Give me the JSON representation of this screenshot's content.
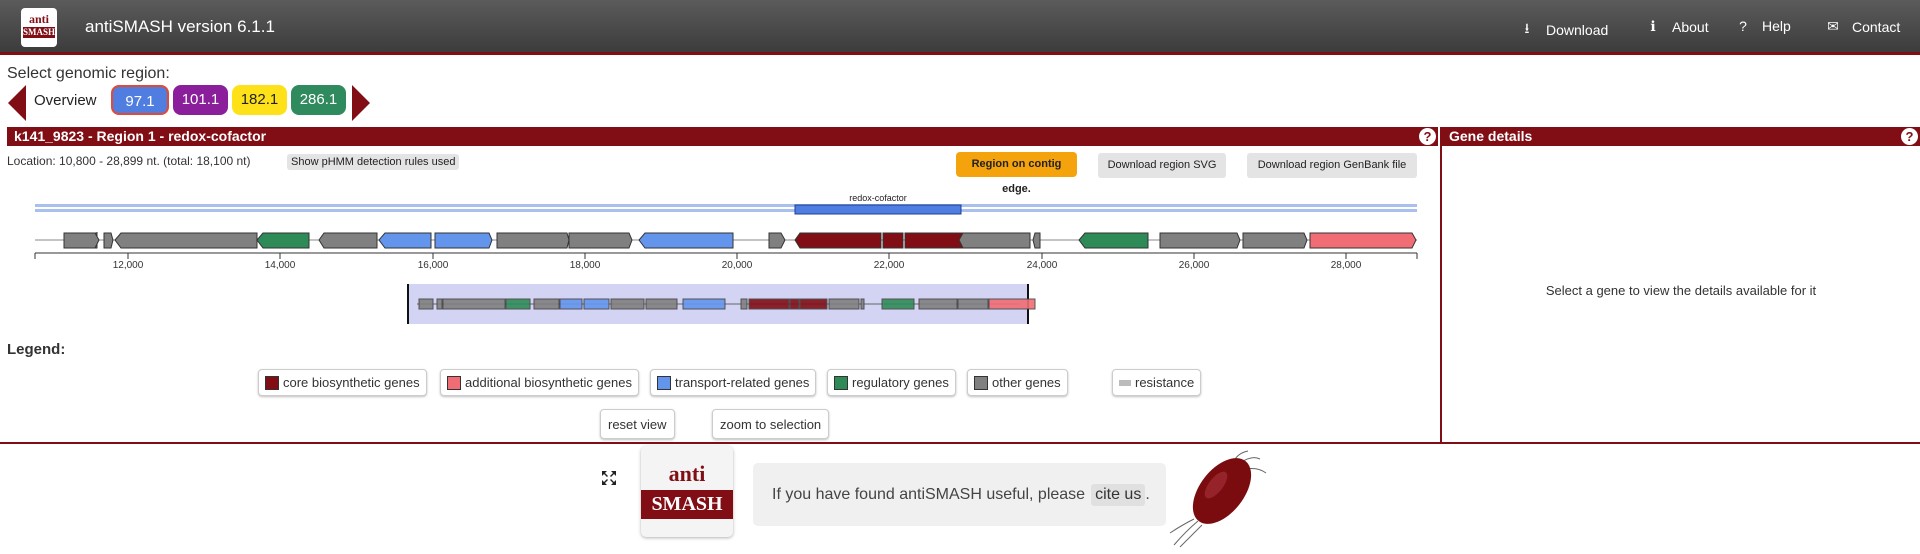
{
  "header": {
    "logo_top": "anti",
    "logo_bottom": "SMASH",
    "title": "antiSMASH version 6.1.1",
    "nav": [
      {
        "label": "Download",
        "icon": "download-icon",
        "glyph": "⭳"
      },
      {
        "label": "About",
        "icon": "info-icon",
        "glyph": "ℹ"
      },
      {
        "label": "Help",
        "icon": "question-icon",
        "glyph": "?"
      },
      {
        "label": "Contact",
        "icon": "envelope-icon",
        "glyph": "✉"
      }
    ]
  },
  "region_select": {
    "label": "Select genomic region:",
    "overview_label": "Overview",
    "regions": [
      {
        "label": "97.1",
        "color": "#4f7de0",
        "selected": true
      },
      {
        "label": "101.1",
        "color": "#8a1e9b"
      },
      {
        "label": "182.1",
        "color": "#ffe11a"
      },
      {
        "label": "286.1",
        "color": "#2f8a5e"
      }
    ]
  },
  "region_panel": {
    "title": "k141_9823 - Region 1 - redox-cofactor",
    "help_glyph": "?",
    "location": "Location: 10,800 - 28,899 nt. (total: 18,100 nt)",
    "rules_button": "Show pHMM detection rules used",
    "edge_badge": "Region on contig edge.",
    "download_svg": "Download region SVG",
    "download_genbank": "Download region GenBank file",
    "protocluster_label": "redox-cofactor",
    "axis_ticks": [
      "12,000",
      "14,000",
      "16,000",
      "18,000",
      "20,000",
      "22,000",
      "24,000",
      "26,000",
      "28,000"
    ]
  },
  "legend": {
    "title": "Legend:",
    "items": [
      {
        "label": "core biosynthetic genes",
        "color": "#810e15"
      },
      {
        "label": "additional biosynthetic genes",
        "color": "#f16d75"
      },
      {
        "label": "transport-related genes",
        "color": "#6495ed"
      },
      {
        "label": "regulatory genes",
        "color": "#2e8b57"
      },
      {
        "label": "other genes",
        "color": "#808080"
      },
      {
        "label": "resistance",
        "color": "#bbbbbb"
      }
    ],
    "reset_view": "reset view",
    "zoom_selection": "zoom to selection"
  },
  "gene_details": {
    "title": "Gene details",
    "placeholder": "Select a gene to view the details available for it"
  },
  "footer": {
    "logo_top": "anti",
    "logo_bottom": "SMASH",
    "cite_text": "If you have found antiSMASH useful, please",
    "cite_link": "cite us",
    "cite_end": "."
  },
  "colors": {
    "brand": "#810e15",
    "core": "#810e15",
    "additional": "#f16d75",
    "transport": "#6495ed",
    "regulatory": "#2e8b57",
    "other": "#808080"
  }
}
